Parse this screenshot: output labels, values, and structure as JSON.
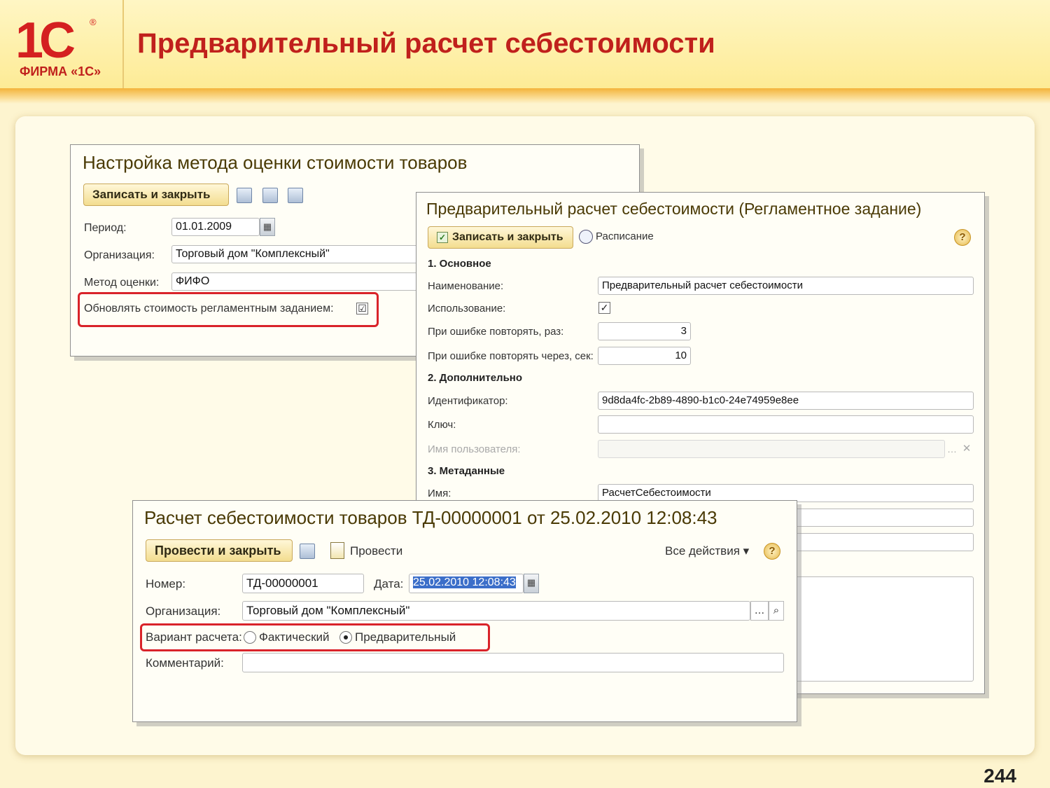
{
  "slide": {
    "logo_text": "1С",
    "logo_reg": "®",
    "logo_firm": "ФИРМА «1С»",
    "title": "Предварительный расчет себестоимости",
    "page_number": "244"
  },
  "window_settings": {
    "title": "Настройка метода оценки стоимости товаров",
    "save_close_label": "Записать и закрыть",
    "period_label": "Период:",
    "period_value": "01.01.2009",
    "org_label": "Организация:",
    "org_value": "Торговый дом \"Комплексный\"",
    "method_label": "Метод оценки:",
    "method_value": "ФИФО",
    "update_label": "Обновлять стоимость регламентным заданием:",
    "update_checked": "☑"
  },
  "window_job": {
    "title": "Предварительный расчет себестоимости (Регламентное задание)",
    "save_close_label": "Записать и закрыть",
    "schedule_label": "Расписание",
    "help": "?",
    "section1": "1. Основное",
    "name_label": "Наименование:",
    "name_value": "Предварительный расчет себестоимости",
    "use_label": "Использование:",
    "use_checked": "✓",
    "retry_count_label": "При ошибке повторять, раз:",
    "retry_count_value": "3",
    "retry_delay_label": "При ошибке повторять через, сек:",
    "retry_delay_value": "10",
    "section2": "2. Дополнительно",
    "id_label": "Идентификатор:",
    "id_value": "9d8da4fc-2b89-4890-b1c0-24e74959e8ee",
    "key_label": "Ключ:",
    "key_value": "",
    "user_label": "Имя пользователя:",
    "user_value": "",
    "section3": "3. Метаданные",
    "meta_name_label": "Имя:",
    "meta_name_value": "РасчетСебестоимости"
  },
  "window_doc": {
    "title": "Расчет себестоимости товаров ТД-00000001 от 25.02.2010 12:08:43",
    "post_close_label": "Провести и закрыть",
    "post_label": "Провести",
    "all_actions_label": "Все действия ▾",
    "help": "?",
    "number_label": "Номер:",
    "number_value": "ТД-00000001",
    "date_label": "Дата:",
    "date_value": "25.02.2010 12:08:43",
    "org_label": "Организация:",
    "org_value": "Торговый дом \"Комплексный\"",
    "variant_label": "Вариант расчета:",
    "variant_actual": "Фактический",
    "variant_preliminary": "Предварительный",
    "comment_label": "Комментарий:",
    "comment_value": ""
  }
}
